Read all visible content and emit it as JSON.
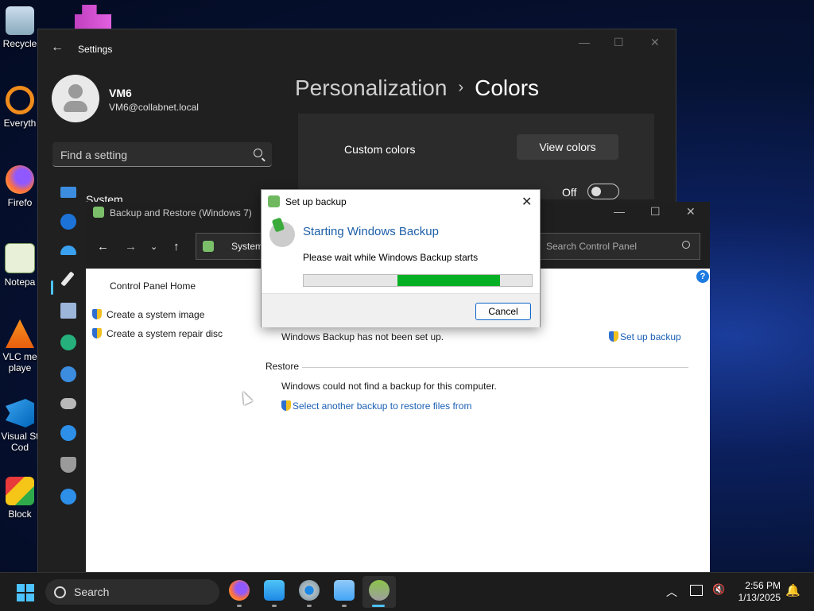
{
  "desktop": {
    "icons": [
      {
        "label": "Recycle",
        "icon": "recycle-bin-icon"
      },
      {
        "label": "Everyth",
        "icon": "everything-search-icon"
      },
      {
        "label": "Firefo",
        "icon": "firefox-icon"
      },
      {
        "label": "Notepa",
        "icon": "notepad-icon"
      },
      {
        "label": "VLC me",
        "label2": "playe",
        "icon": "vlc-icon"
      },
      {
        "label": "Visual St",
        "label2": "Cod",
        "icon": "vscode-icon"
      },
      {
        "label": "Block",
        "icon": "blocks-icon"
      }
    ]
  },
  "settings": {
    "window_title": "Settings",
    "user_name": "VM6",
    "user_email": "VM6@collabnet.local",
    "search_placeholder": "Find a setting",
    "nav_first": "System",
    "breadcrumb_parent": "Personalization",
    "breadcrumb_sep": "›",
    "breadcrumb_current": "Colors",
    "custom_colors_label": "Custom colors",
    "view_colors_button": "View colors",
    "toggle_state_label": "Off"
  },
  "control_panel": {
    "window_title": "Backup and Restore (Windows 7)",
    "address_text": "System",
    "search_placeholder": "Search Control Panel",
    "sidebar_home": "Control Panel Home",
    "sidebar_links": [
      "Create a system image",
      "Create a system repair disc"
    ],
    "backup_status": "Windows Backup has not been set up.",
    "setup_backup_link": "Set up backup",
    "restore_heading": "Restore",
    "restore_status": "Windows could not find a backup for this computer.",
    "restore_link": "Select another backup to restore files from"
  },
  "dialog": {
    "title": "Set up backup",
    "heading": "Starting Windows Backup",
    "message": "Please wait while Windows Backup starts",
    "progress": {
      "start": 0.41,
      "end": 0.86
    },
    "cancel_button": "Cancel"
  },
  "taskbar": {
    "search_label": "Search",
    "time": "2:56 PM",
    "date": "1/13/2025"
  },
  "colors": {
    "accent": "#4cc2ff",
    "progress": "#06b025",
    "link": "#1a5fb4"
  }
}
